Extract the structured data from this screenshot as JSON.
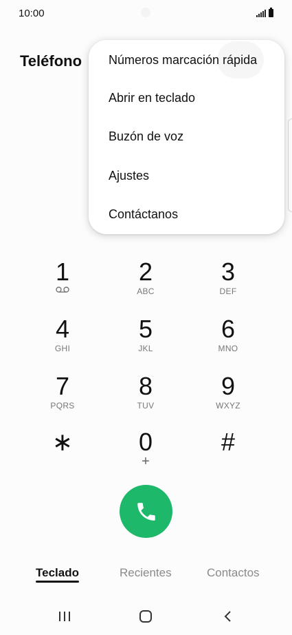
{
  "status_bar": {
    "time": "10:00"
  },
  "header": {
    "title": "Teléfono"
  },
  "menu": {
    "items": [
      {
        "label": "Números marcación rápida"
      },
      {
        "label": "Abrir en teclado"
      },
      {
        "label": "Buzón de voz"
      },
      {
        "label": "Ajustes"
      },
      {
        "label": "Contáctanos"
      }
    ]
  },
  "keypad": {
    "keys": [
      {
        "digit": "1",
        "letters": ""
      },
      {
        "digit": "2",
        "letters": "ABC"
      },
      {
        "digit": "3",
        "letters": "DEF"
      },
      {
        "digit": "4",
        "letters": "GHI"
      },
      {
        "digit": "5",
        "letters": "JKL"
      },
      {
        "digit": "6",
        "letters": "MNO"
      },
      {
        "digit": "7",
        "letters": "PQRS"
      },
      {
        "digit": "8",
        "letters": "TUV"
      },
      {
        "digit": "9",
        "letters": "WXYZ"
      },
      {
        "digit": "∗",
        "letters": ""
      },
      {
        "digit": "0",
        "letters": "+"
      },
      {
        "digit": "#",
        "letters": ""
      }
    ]
  },
  "call": {
    "icon": "phone-icon",
    "color": "#1db86a"
  },
  "tabs": [
    {
      "label": "Teclado",
      "active": true
    },
    {
      "label": "Recientes",
      "active": false
    },
    {
      "label": "Contactos",
      "active": false
    }
  ],
  "navbar": {
    "icons": [
      "recent-apps-icon",
      "home-icon",
      "back-icon"
    ]
  }
}
